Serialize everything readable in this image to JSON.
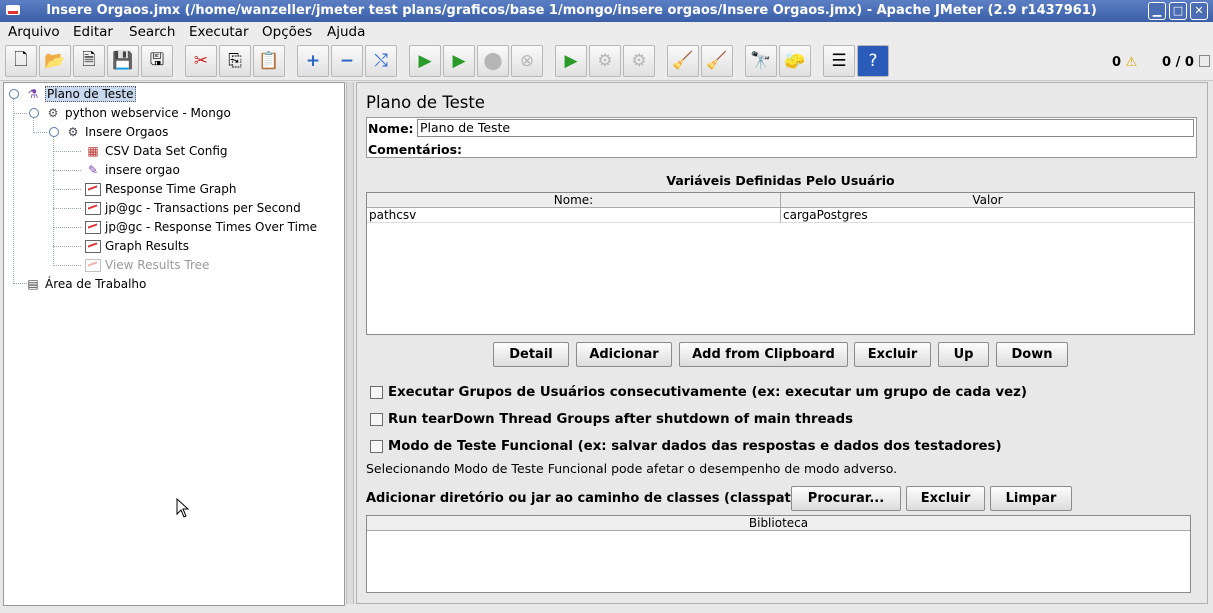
{
  "window": {
    "title": "Insere Orgaos.jmx (/home/wanzeller/jmeter test plans/graficos/base 1/mongo/insere orgaos/Insere Orgaos.jmx) - Apache JMeter (2.9 r1437961)"
  },
  "menu": [
    "Arquivo",
    "Editar",
    "Search",
    "Executar",
    "Opções",
    "Ajuda"
  ],
  "status": {
    "warnings": "0",
    "threads": "0 / 0"
  },
  "tree": [
    {
      "label": "Plano de Teste",
      "icon": "test-plan-icon"
    },
    {
      "label": "python webservice - Mongo",
      "icon": "thread-group-icon"
    },
    {
      "label": "Insere Orgaos",
      "icon": "controller-icon"
    },
    {
      "label": "CSV Data Set Config",
      "icon": "csv-config-icon"
    },
    {
      "label": "insere orgao",
      "icon": "sampler-icon"
    },
    {
      "label": "Response Time Graph",
      "icon": "graph-icon"
    },
    {
      "label": "jp@gc - Transactions per Second",
      "icon": "graph-icon"
    },
    {
      "label": "jp@gc - Response Times Over Time",
      "icon": "graph-icon"
    },
    {
      "label": "Graph Results",
      "icon": "graph-icon"
    },
    {
      "label": "View Results Tree",
      "icon": "graph-icon"
    },
    {
      "label": "Área de Trabalho",
      "icon": "workbench-icon"
    }
  ],
  "panel": {
    "title": "Plano de Teste",
    "name_label": "Nome:",
    "name_value": "Plano de Teste",
    "comments_label": "Comentários:",
    "comments_value": "",
    "vars_title": "Variáveis Definidas Pelo Usuário",
    "vars_columns": [
      "Nome:",
      "Valor"
    ],
    "vars_rows": [
      {
        "name": "pathcsv",
        "value": "cargaPostgres"
      }
    ],
    "buttons": [
      "Detail",
      "Adicionar",
      "Add from Clipboard",
      "Excluir",
      "Up",
      "Down"
    ],
    "checkboxes": [
      {
        "label": "Executar Grupos de Usuários consecutivamente (ex: executar um grupo de cada vez)",
        "checked": false
      },
      {
        "label": "Run tearDown Thread Groups after shutdown of main threads",
        "checked": false
      },
      {
        "label": "Modo de Teste Funcional (ex: salvar dados das respostas e dados dos testadores)",
        "checked": false
      }
    ],
    "functional_note": "Selecionando Modo de Teste Funcional pode afetar o desempenho de modo adverso.",
    "classpath_label": "Adicionar diretório ou jar ao caminho de classes (classpath)",
    "classpath_buttons": [
      "Procurar...",
      "Excluir",
      "Limpar"
    ],
    "library_header": "Biblioteca"
  }
}
